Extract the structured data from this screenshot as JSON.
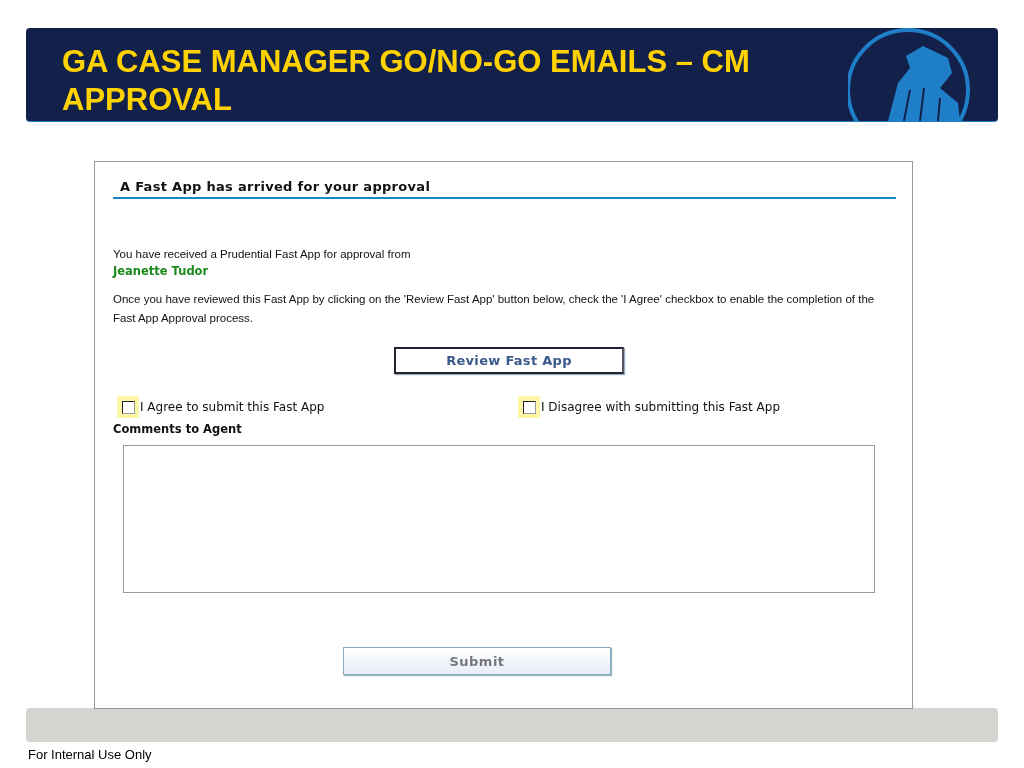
{
  "slide": {
    "title": "GA CASE MANAGER GO/NO-GO EMAILS – CM APPROVAL",
    "footer": "For Internal Use Only"
  },
  "email": {
    "heading": "A Fast App has arrived for your approval",
    "intro": "You have received a Prudential Fast App for approval from",
    "sender": "Jeanette Tudor",
    "instructions": "Once you have reviewed this Fast App by clicking on the 'Review Fast App' button below, check the 'I Agree' checkbox to enable the completion of the Fast App Approval process.",
    "review_button": "Review Fast App",
    "options": [
      {
        "label": "I Agree to submit this Fast App",
        "checked": false
      },
      {
        "label": "I Disagree with submitting this Fast App",
        "checked": false
      }
    ],
    "comments_label": "Comments to Agent",
    "submit_button": {
      "label": "Submit",
      "disabled": true
    }
  }
}
